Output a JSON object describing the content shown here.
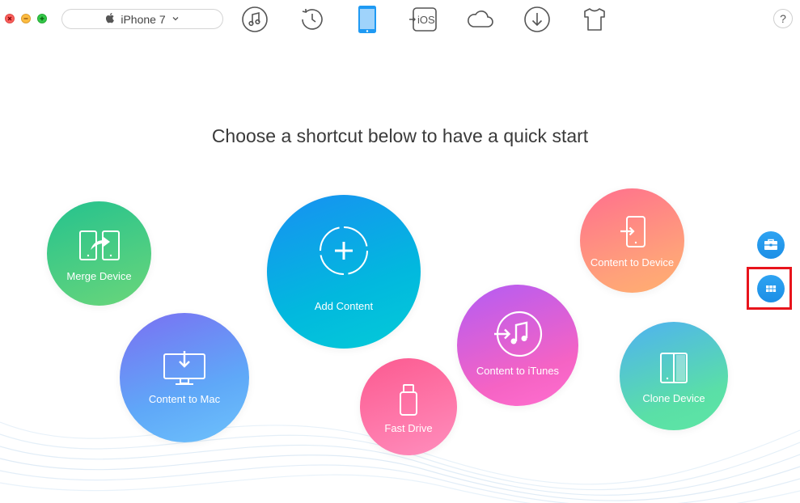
{
  "window": {
    "controls": [
      "close",
      "minimize",
      "maximize"
    ]
  },
  "toolbar": {
    "device_name": "iPhone 7",
    "device_icon": "apple-icon",
    "tools": [
      {
        "name": "music-tool-icon",
        "label": "Music"
      },
      {
        "name": "history-tool-icon",
        "label": "Backup History"
      },
      {
        "name": "device-tool-icon",
        "label": "Device",
        "active": true
      },
      {
        "name": "ios-mover-tool-icon",
        "label": "iOS"
      },
      {
        "name": "icloud-tool-icon",
        "label": "iCloud"
      },
      {
        "name": "download-tool-icon",
        "label": "Download"
      },
      {
        "name": "shirt-tool-icon",
        "label": "Theme"
      }
    ],
    "help_label": "?"
  },
  "main": {
    "headline": "Choose a shortcut below to have a quick start",
    "shortcuts": {
      "merge_device": "Merge Device",
      "content_to_mac": "Content to Mac",
      "add_content": "Add Content",
      "fast_drive": "Fast Drive",
      "content_to_itunes": "Content to iTunes",
      "content_to_device": "Content to Device",
      "clone_device": "Clone Device"
    }
  },
  "side": {
    "toolbox_icon": "toolbox-icon",
    "grid_icon": "grid-icon"
  },
  "colors": {
    "accent": "#1c8fe6",
    "highlight": "#e8141c",
    "active_tool": "#1f9af3"
  }
}
